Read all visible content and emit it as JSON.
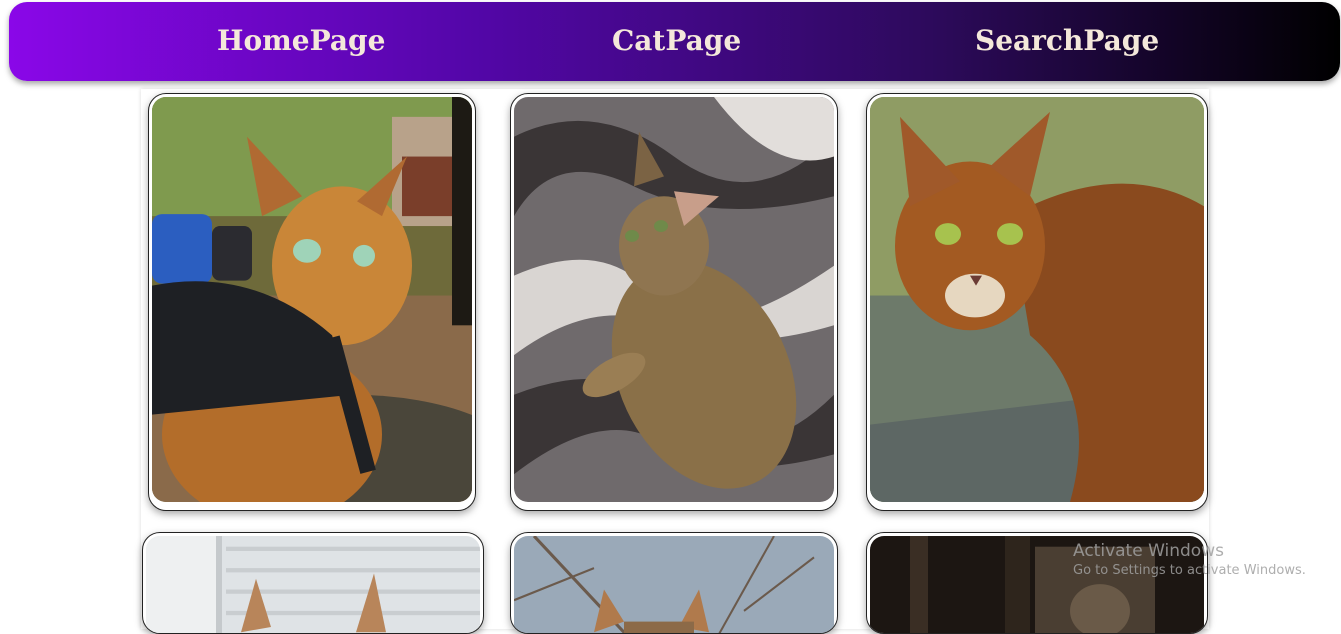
{
  "nav": {
    "links": [
      {
        "label": "HomePage"
      },
      {
        "label": "CatPage"
      },
      {
        "label": "SearchPage"
      }
    ]
  },
  "gallery": {
    "cards": [
      {
        "alt": "bengal cat wearing black harness outdoors"
      },
      {
        "alt": "tabby kitten lying on fur blanket"
      },
      {
        "alt": "bengal cat standing on stone path"
      },
      {
        "alt": "cat peeking near window blinds"
      },
      {
        "alt": "cat outdoors under branches"
      },
      {
        "alt": "cat in dark interior"
      }
    ]
  },
  "watermark": {
    "title": "Activate Windows",
    "subtitle": "Go to Settings to activate Windows."
  },
  "colors": {
    "nav_gradient_start": "#8a07e8",
    "nav_gradient_end": "#000000",
    "nav_text": "#f4e8da"
  }
}
